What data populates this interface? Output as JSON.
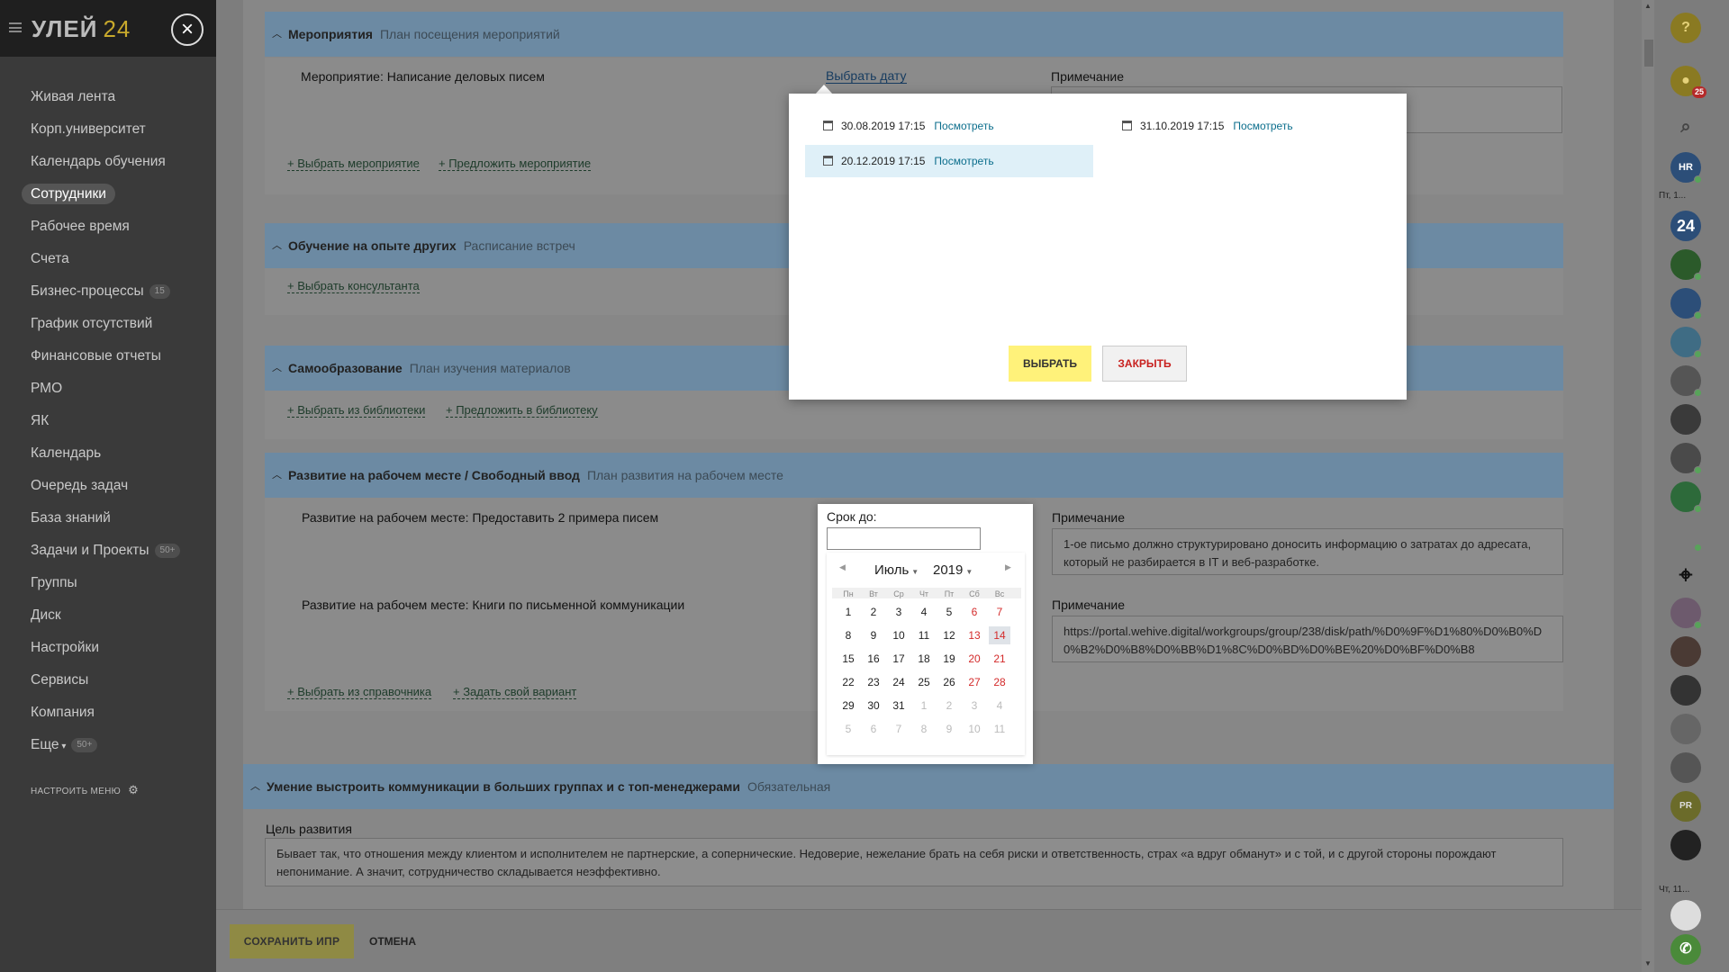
{
  "sidebar": {
    "logo": "УЛЕЙ",
    "logo_num": "24",
    "close_glyph": "×",
    "items": [
      {
        "label": "Живая лента"
      },
      {
        "label": "Корп.университет"
      },
      {
        "label": "Календарь обучения"
      },
      {
        "label": "Сотрудники",
        "active": true
      },
      {
        "label": "Рабочее время"
      },
      {
        "label": "Счета"
      },
      {
        "label": "Бизнес-процессы",
        "badge": "15"
      },
      {
        "label": "График отсутствий"
      },
      {
        "label": "Финансовые отчеты"
      },
      {
        "label": "РМО"
      },
      {
        "label": "ЯК"
      },
      {
        "label": "Календарь"
      },
      {
        "label": "Очередь задач"
      },
      {
        "label": "База знаний"
      },
      {
        "label": "Задачи и Проекты",
        "badge": "50+"
      },
      {
        "label": "Группы"
      },
      {
        "label": "Диск"
      },
      {
        "label": "Настройки"
      },
      {
        "label": "Сервисы"
      },
      {
        "label": "Компания"
      },
      {
        "label": "Еще",
        "badge": "50+"
      }
    ],
    "configure": "НАСТРОИТЬ МЕНЮ"
  },
  "sections": {
    "events": {
      "title": "Мероприятия",
      "subtitle": "План посещения мероприятий",
      "item": "Мероприятие: Написание деловых писем",
      "choose_date": "Выбрать дату",
      "note_label": "Примечание",
      "link1": "+ Выбрать мероприятие",
      "link2": "+ Предложить мероприятие"
    },
    "others": {
      "title": "Обучение на опыте других",
      "subtitle": "Расписание встреч",
      "link1": "+ Выбрать консультанта"
    },
    "self": {
      "title": "Самообразование",
      "subtitle": "План изучения материалов",
      "link1": "+ Выбрать из библиотеки",
      "link2": "+ Предложить в библиотеку"
    },
    "workplace": {
      "title": "Развитие на рабочем месте / Свободный ввод",
      "subtitle": "План развития на рабочем месте",
      "item1": "Развитие на рабочем месте: Предоставить 2 примера писем",
      "note1_label": "Примечание",
      "note1": "1-ое письмо должно структурировано доносить информацию о затратах до адресата, который не разбирается в IT  и веб-разработке.",
      "item2": "Развитие на рабочем месте: Книги по письменной коммуникации",
      "note2_label": "Примечание",
      "note2": "https://portal.wehive.digital/workgroups/group/238/disk/path/%D0%9F%D1%80%D0%B0%D0%B2%D0%B8%D0%BB%D1%8C%D0%BD%D0%BE%20%D0%BF%D0%B8",
      "link1": "+ Выбрать из справочника",
      "link2": "+ Задать свой вариант"
    },
    "comm": {
      "title": "Умение выстроить коммуникации в больших группах и с топ-менеджерами",
      "subtitle": "Обязательная",
      "goal_label": "Цель развития",
      "goal": "Бывает так, что отношения между клиентом и исполнителем не партнерские, а сопернические. Недоверие, нежелание брать на себя риски и ответственность, страх «а вдруг обманут» и с той, и с другой стороны порождают непонимание. А значит, сотрудничество складывается неэффективно."
    }
  },
  "footer": {
    "save": "СОХРАНИТЬ ИПР",
    "cancel": "ОТМЕНА"
  },
  "modal": {
    "dates": [
      {
        "date": "30.08.2019 17:15",
        "view": "Посмотреть"
      },
      {
        "date": "31.10.2019 17:15",
        "view": "Посмотреть"
      },
      {
        "date": "20.12.2019 17:15",
        "view": "Посмотреть",
        "selected": true
      }
    ],
    "choose": "ВЫБРАТЬ",
    "close": "ЗАКРЫТЬ"
  },
  "datepicker": {
    "label": "Срок до:",
    "input_value": "",
    "month": "Июль",
    "year": "2019",
    "weekdays": [
      "Пн",
      "Вт",
      "Ср",
      "Чт",
      "Пт",
      "Сб",
      "Вс"
    ],
    "weeks": [
      [
        "1",
        "2",
        "3",
        "4",
        "5",
        "6",
        "7"
      ],
      [
        "8",
        "9",
        "10",
        "11",
        "12",
        "13",
        "14"
      ],
      [
        "15",
        "16",
        "17",
        "18",
        "19",
        "20",
        "21"
      ],
      [
        "22",
        "23",
        "24",
        "25",
        "26",
        "27",
        "28"
      ],
      [
        "29",
        "30",
        "31",
        "1",
        "2",
        "3",
        "4"
      ],
      [
        "5",
        "6",
        "7",
        "8",
        "9",
        "10",
        "11"
      ]
    ],
    "today": "14"
  },
  "rightbar": {
    "help": "?",
    "notif_count": "25",
    "label1": "Пт, 1...",
    "label2": "Чт, 11...",
    "hr": "HR",
    "b24": "24",
    "pr": "PR"
  }
}
